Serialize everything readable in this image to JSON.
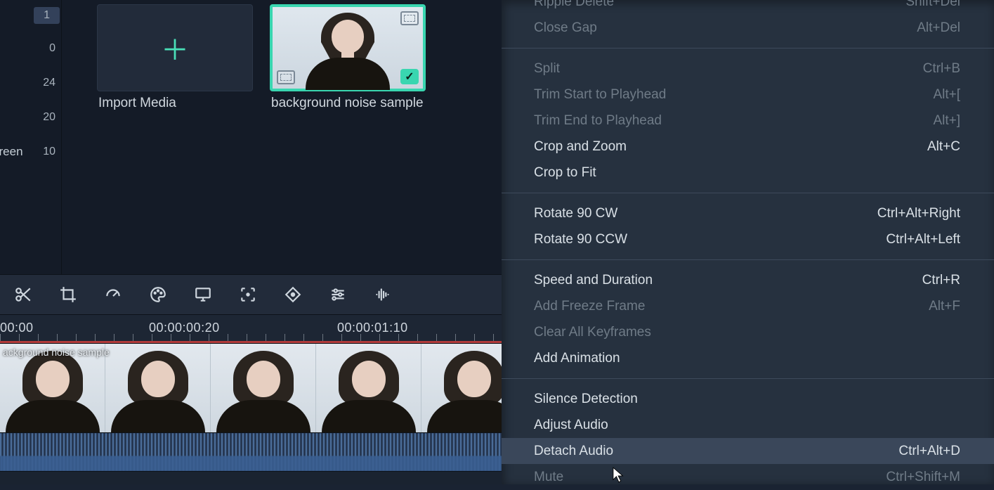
{
  "ruler": {
    "ticks": [
      "1",
      "0",
      "24",
      "20",
      "10"
    ],
    "word": "creen"
  },
  "media": {
    "import_label": "Import Media",
    "clip_label": "background noise sample"
  },
  "toolbar": {
    "icons": [
      "scissors-icon",
      "crop-icon",
      "speed-icon",
      "palette-icon",
      "screen-icon",
      "focus-icon",
      "keyframe-icon",
      "sliders-icon",
      "audio-eq-icon"
    ]
  },
  "timeline": {
    "labels": [
      "00:00",
      "00:00:00:20",
      "00:00:01:10"
    ],
    "clip_name": "ackground noise sample"
  },
  "menu": [
    {
      "type": "item",
      "label": "Ripple Delete",
      "shortcut": "Shift+Del",
      "disabled": true
    },
    {
      "type": "item",
      "label": "Close Gap",
      "shortcut": "Alt+Del",
      "disabled": true
    },
    {
      "type": "sep"
    },
    {
      "type": "item",
      "label": "Split",
      "shortcut": "Ctrl+B",
      "disabled": true
    },
    {
      "type": "item",
      "label": "Trim Start to Playhead",
      "shortcut": "Alt+[",
      "disabled": true
    },
    {
      "type": "item",
      "label": "Trim End to Playhead",
      "shortcut": "Alt+]",
      "disabled": true
    },
    {
      "type": "item",
      "label": "Crop and Zoom",
      "shortcut": "Alt+C",
      "disabled": false
    },
    {
      "type": "item",
      "label": "Crop to Fit",
      "shortcut": "",
      "disabled": false
    },
    {
      "type": "sep"
    },
    {
      "type": "item",
      "label": "Rotate 90 CW",
      "shortcut": "Ctrl+Alt+Right",
      "disabled": false
    },
    {
      "type": "item",
      "label": "Rotate 90 CCW",
      "shortcut": "Ctrl+Alt+Left",
      "disabled": false
    },
    {
      "type": "sep"
    },
    {
      "type": "item",
      "label": "Speed and Duration",
      "shortcut": "Ctrl+R",
      "disabled": false
    },
    {
      "type": "item",
      "label": "Add Freeze Frame",
      "shortcut": "Alt+F",
      "disabled": true
    },
    {
      "type": "item",
      "label": "Clear All Keyframes",
      "shortcut": "",
      "disabled": true
    },
    {
      "type": "item",
      "label": "Add Animation",
      "shortcut": "",
      "disabled": false
    },
    {
      "type": "sep"
    },
    {
      "type": "item",
      "label": "Silence Detection",
      "shortcut": "",
      "disabled": false
    },
    {
      "type": "item",
      "label": "Adjust Audio",
      "shortcut": "",
      "disabled": false
    },
    {
      "type": "item",
      "label": "Detach Audio",
      "shortcut": "Ctrl+Alt+D",
      "disabled": false,
      "hover": true
    },
    {
      "type": "item",
      "label": "Mute",
      "shortcut": "Ctrl+Shift+M",
      "disabled": true
    }
  ]
}
